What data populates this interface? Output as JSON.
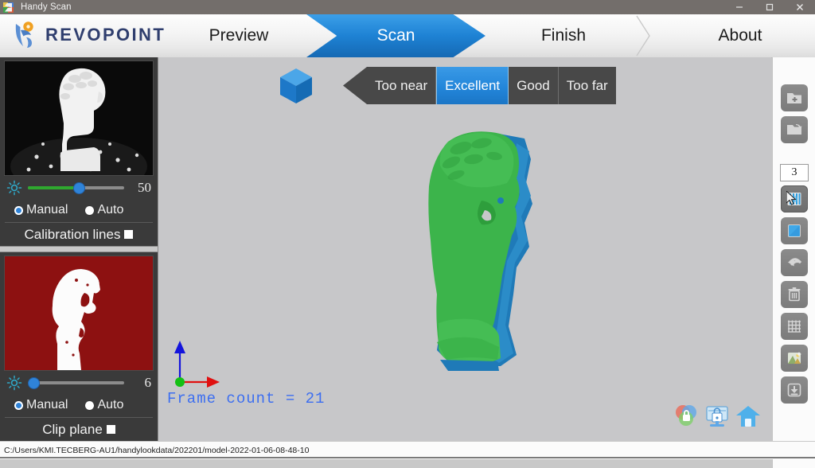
{
  "window": {
    "title": "Handy Scan",
    "app_icon": "app-logo-icon",
    "minimize_label": "minimize-icon",
    "maximize_label": "maximize-icon",
    "close_label": "close-icon"
  },
  "header": {
    "brand": "REVOPOINT",
    "brand_color": "#2f3e6e",
    "tabs": [
      {
        "label": "Preview",
        "active": false
      },
      {
        "label": "Scan",
        "active": true
      },
      {
        "label": "Finish",
        "active": false
      },
      {
        "label": "About",
        "active": false
      }
    ],
    "active_tab_color": "#1e82d4"
  },
  "sidebar": {
    "panels": [
      {
        "preview_name": "rgb-camera-preview",
        "brightness_icon": "brightness-sun-icon",
        "value": "50",
        "slider_percent": 52,
        "fill_color": "#2fa82f",
        "modes": [
          {
            "label": "Manual",
            "selected": true
          },
          {
            "label": "Auto",
            "selected": false
          }
        ],
        "toggle": {
          "label": "Calibration lines",
          "checked": true
        }
      },
      {
        "preview_name": "depth-camera-preview",
        "brightness_icon": "brightness-sun-icon",
        "value": "6",
        "slider_percent": 6,
        "fill_color": "#8c8c8c",
        "modes": [
          {
            "label": "Manual",
            "selected": true
          },
          {
            "label": "Auto",
            "selected": false
          }
        ],
        "toggle": {
          "label": "Clip plane",
          "checked": true
        }
      }
    ]
  },
  "viewport": {
    "orientation_cube": "orientation-cube-icon",
    "distance_indicator": {
      "segments": [
        {
          "label": "Too near",
          "active": false
        },
        {
          "label": "Excellent",
          "active": true
        },
        {
          "label": "Good",
          "active": false
        },
        {
          "label": "Too far",
          "active": false
        }
      ],
      "active_color": "#2386da",
      "background_color": "#484848"
    },
    "frame_count": "Frame count = 21",
    "frame_count_color": "#3c6ef0",
    "axis_gizmo": {
      "x_color": "#e01010",
      "y_color": "#1414dc",
      "origin_color": "#14c014"
    },
    "model": {
      "name": "scan-mesh",
      "front_color": "#3cb44b",
      "back_color": "#1f7ab8"
    },
    "floating_buttons": [
      {
        "name": "color-lock-icon"
      },
      {
        "name": "screen-lock-icon"
      },
      {
        "name": "home-view-icon"
      }
    ]
  },
  "toolbar": {
    "buttons": [
      {
        "name": "new-project-icon",
        "selected": false
      },
      {
        "name": "open-project-icon",
        "selected": false
      }
    ],
    "counter_value": "3",
    "buttons2": [
      {
        "name": "scan-fringe-icon",
        "selected": true
      },
      {
        "name": "fuse-cube-icon",
        "selected": false
      },
      {
        "name": "undo-icon",
        "selected": false
      },
      {
        "name": "delete-icon",
        "selected": false
      },
      {
        "name": "mesh-grid-icon",
        "selected": false
      },
      {
        "name": "texture-map-icon",
        "selected": false
      },
      {
        "name": "save-download-icon",
        "selected": false
      }
    ]
  },
  "statusbar": {
    "path": "C:/Users/KMI.TECBERG-AU1/handylookdata/202201/model-2022-01-06-08-48-10"
  }
}
